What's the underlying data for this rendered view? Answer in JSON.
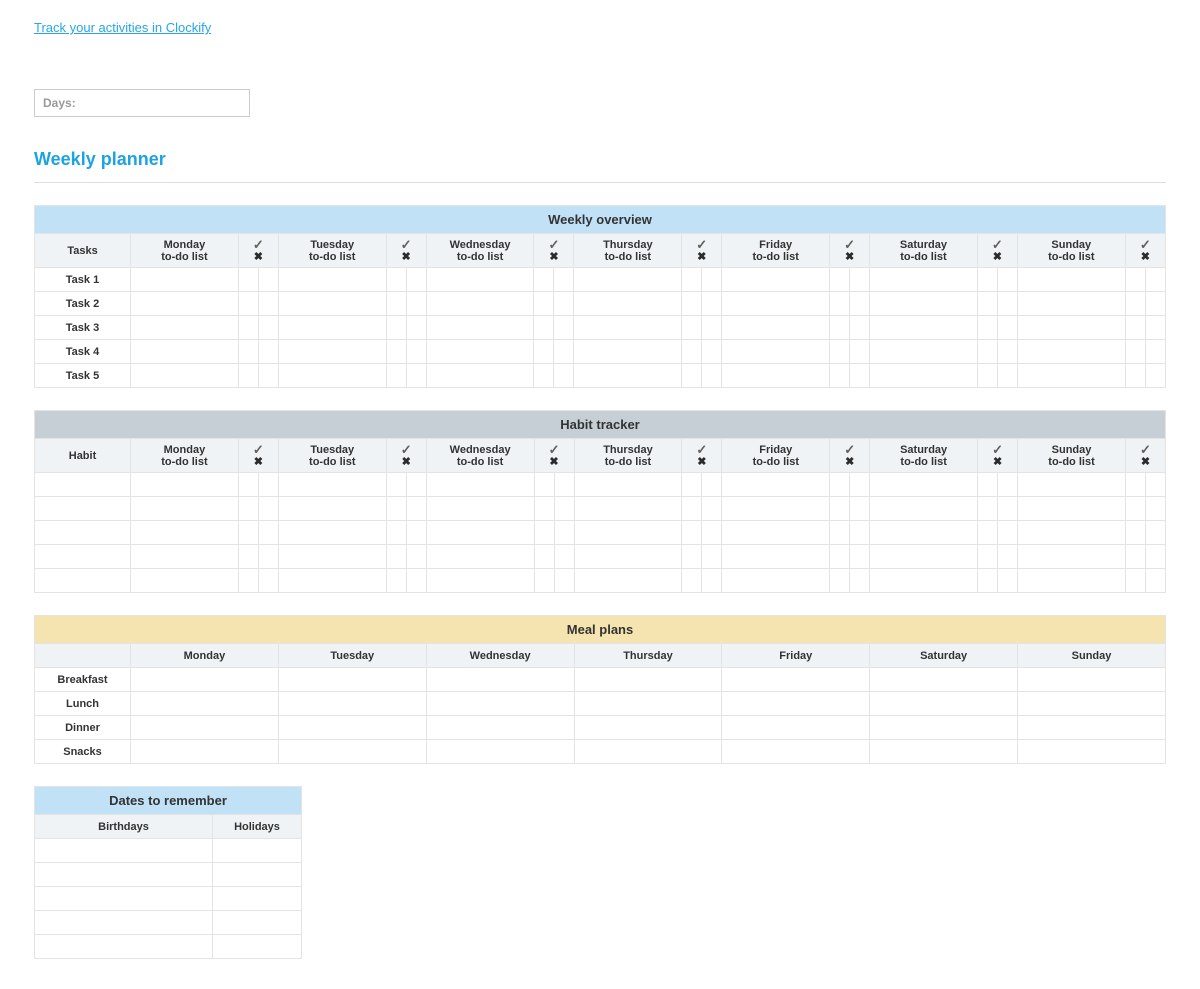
{
  "top_link": "Track your activities in Clockify",
  "days_label": "Days:",
  "title": "Weekly planner",
  "days": [
    "Monday",
    "Tuesday",
    "Wednesday",
    "Thursday",
    "Friday",
    "Saturday",
    "Sunday"
  ],
  "todo_sub": "to-do list",
  "weekly_overview": {
    "header": "Weekly overview",
    "corner": "Tasks",
    "rows": [
      "Task 1",
      "Task 2",
      "Task 3",
      "Task 4",
      "Task 5"
    ]
  },
  "habit_tracker": {
    "header": "Habit tracker",
    "corner": "Habit",
    "rows": [
      "",
      "",
      "",
      "",
      ""
    ]
  },
  "meal_plans": {
    "header": "Meal plans",
    "rows": [
      "Breakfast",
      "Lunch",
      "Dinner",
      "Snacks"
    ]
  },
  "dates": {
    "header": "Dates to remember",
    "cols": [
      "Birthdays",
      "Holidays"
    ],
    "row_count": 5
  }
}
